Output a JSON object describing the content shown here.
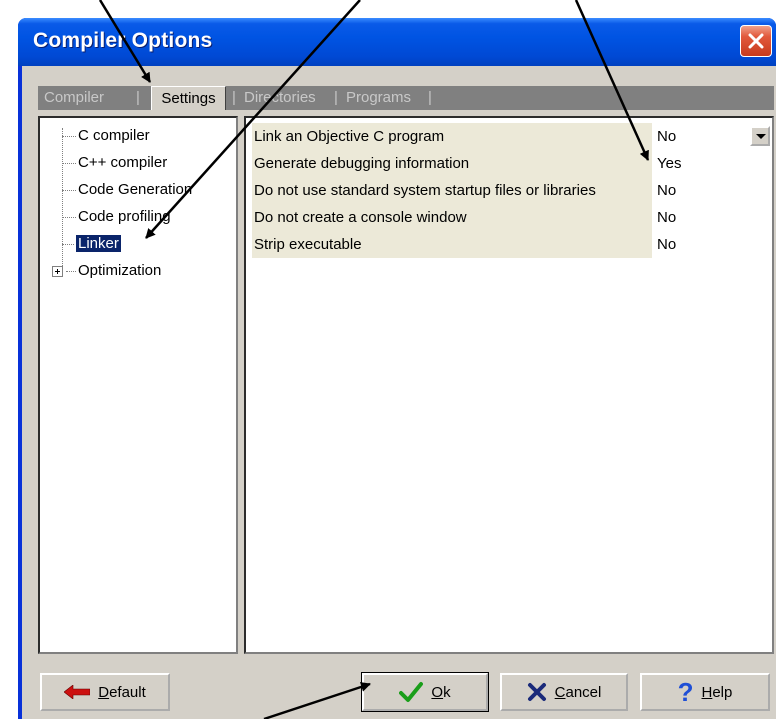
{
  "window": {
    "title": "Compiler Options"
  },
  "tabs": {
    "compiler": "Compiler",
    "settings": "Settings",
    "directories": "Directories",
    "programs": "Programs",
    "separator": "|"
  },
  "tree": {
    "items": [
      "C compiler",
      "C++ compiler",
      "Code Generation",
      "Code profiling",
      "Linker",
      "Optimization"
    ],
    "selected": "Linker"
  },
  "properties": [
    {
      "name": "Link an Objective  C program",
      "value": "No"
    },
    {
      "name": "Generate debugging information",
      "value": "Yes"
    },
    {
      "name": "Do not use standard system startup files or libraries",
      "value": "No"
    },
    {
      "name": "Do not create a console window",
      "value": "No"
    },
    {
      "name": "Strip executable",
      "value": "No"
    }
  ],
  "buttons": {
    "default_mnemonic": "D",
    "default_rest": "efault",
    "ok_mnemonic": "O",
    "ok_rest": "k",
    "cancel_mnemonic": "C",
    "cancel_rest": "ancel",
    "help_mnemonic": "H",
    "help_rest": "elp"
  },
  "icons": {
    "close": "close-icon",
    "default": "arrow-left-icon",
    "ok": "checkmark-icon",
    "cancel": "x-icon",
    "help": "question-icon"
  },
  "colors": {
    "titlebar": "#0054e3",
    "close": "#e2593c",
    "selection": "#0a246a",
    "ok_check": "#1a9e1a",
    "cancel_x": "#1a2a7a",
    "help_q": "#1f4fd6",
    "default_arrow": "#cc1010"
  }
}
